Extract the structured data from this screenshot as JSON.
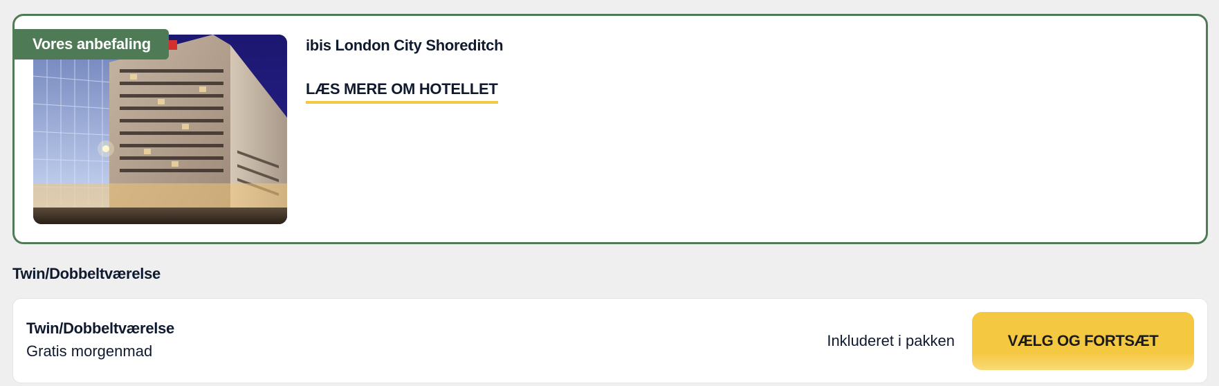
{
  "hotel": {
    "badge": "Vores anbefaling",
    "name": "ibis London City Shoreditch",
    "read_more_label": "LÆS MERE OM HOTELLET",
    "photo_icon": "hotel-building-photo"
  },
  "rooms": {
    "heading": "Twin/Dobbeltværelse",
    "options": [
      {
        "name": "Twin/Dobbeltværelse",
        "feature": "Gratis morgenmad",
        "price_label": "Inkluderet i pakken",
        "select_label": "VÆLG OG FORTSÆT"
      }
    ]
  },
  "colors": {
    "accent_green": "#4e7a55",
    "accent_yellow": "#f5c842",
    "text_dark": "#0f1a2e",
    "background": "#efefef"
  }
}
